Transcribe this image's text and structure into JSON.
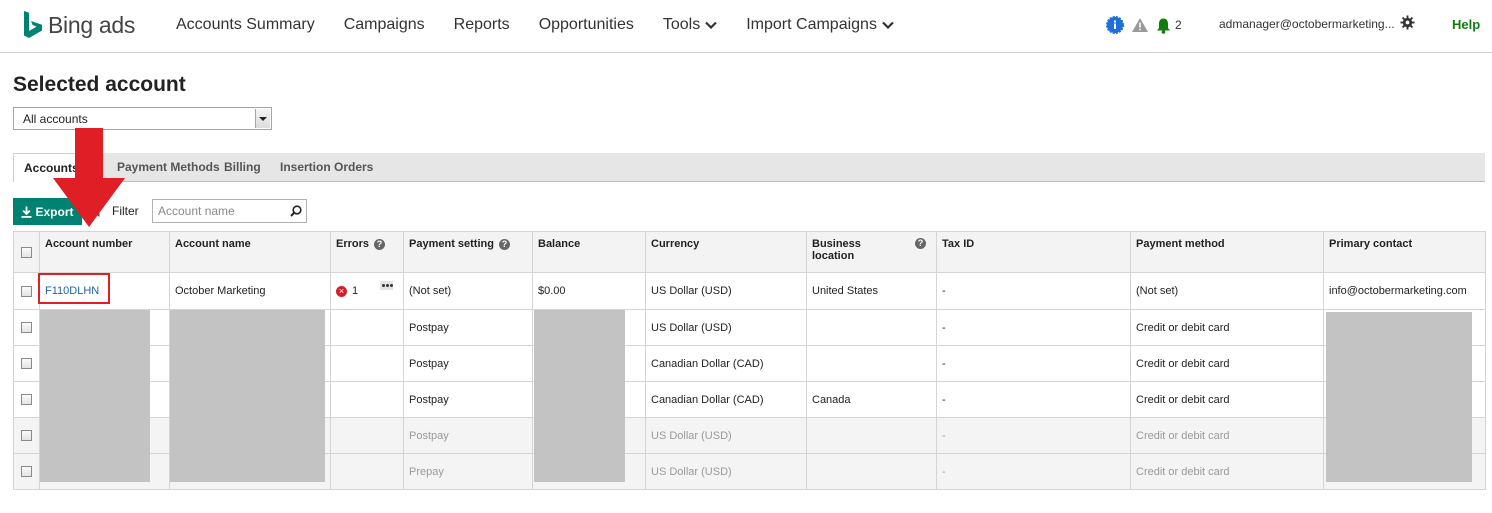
{
  "brand": {
    "name": "Bing ads",
    "color": "#008373"
  },
  "nav": {
    "items": [
      {
        "label": "Accounts Summary",
        "has_dropdown": false
      },
      {
        "label": "Campaigns",
        "has_dropdown": false
      },
      {
        "label": "Reports",
        "has_dropdown": false
      },
      {
        "label": "Opportunities",
        "has_dropdown": false
      },
      {
        "label": "Tools",
        "has_dropdown": true
      },
      {
        "label": "Import Campaigns",
        "has_dropdown": true
      }
    ],
    "notification_count": "2",
    "user_email": "admanager@octobermarketing...",
    "help_label": "Help",
    "icons": [
      "info-badge-icon",
      "warning-icon",
      "bell-icon",
      "gear-icon"
    ]
  },
  "page": {
    "title": "Selected account",
    "account_select": {
      "value": "All accounts"
    }
  },
  "tabs": [
    {
      "label": "Accounts",
      "active": true
    },
    {
      "label": "Payment Methods",
      "active": false
    },
    {
      "label": "Billing",
      "active": false
    },
    {
      "label": "Insertion Orders",
      "active": false
    }
  ],
  "toolbar": {
    "export_label": "Export",
    "filter_label": "Filter",
    "search_placeholder": "Account name"
  },
  "grid": {
    "columns": [
      {
        "label": "Account number"
      },
      {
        "label": "Account name"
      },
      {
        "label": "Errors",
        "help": true
      },
      {
        "label": "Payment setting",
        "help": true
      },
      {
        "label": "Balance"
      },
      {
        "label": "Currency"
      },
      {
        "label": "Business location",
        "help": true
      },
      {
        "label": "Tax ID"
      },
      {
        "label": "Payment method"
      },
      {
        "label": "Primary contact"
      }
    ],
    "rows": [
      {
        "account_number": "F110DLHN",
        "account_name": "October Marketing",
        "errors": "1",
        "payment_setting": "(Not set)",
        "balance": "$0.00",
        "currency": "US Dollar (USD)",
        "business_location": "United States",
        "tax_id": "-",
        "payment_method": "(Not set)",
        "primary_contact": "info@octobermarketing.com",
        "dimmed": false
      },
      {
        "account_number": "",
        "account_name": "",
        "errors": "",
        "payment_setting": "Postpay",
        "balance": "",
        "currency": "US Dollar (USD)",
        "business_location": "",
        "tax_id": "-",
        "payment_method": "Credit or debit card",
        "primary_contact": "",
        "dimmed": false
      },
      {
        "account_number": "",
        "account_name": "",
        "errors": "",
        "payment_setting": "Postpay",
        "balance": "",
        "currency": "Canadian Dollar (CAD)",
        "business_location": "",
        "tax_id": "-",
        "payment_method": "Credit or debit card",
        "primary_contact": "",
        "dimmed": false
      },
      {
        "account_number": "",
        "account_name": "",
        "errors": "",
        "payment_setting": "Postpay",
        "balance": "",
        "currency": "Canadian Dollar (CAD)",
        "business_location": "Canada",
        "tax_id": "-",
        "payment_method": "Credit or debit card",
        "primary_contact": "",
        "dimmed": false
      },
      {
        "account_number": "",
        "account_name": "",
        "errors": "",
        "payment_setting": "Postpay",
        "balance": "",
        "currency": "US Dollar (USD)",
        "business_location": "",
        "tax_id": "-",
        "payment_method": "Credit or debit card",
        "primary_contact": "",
        "dimmed": true
      },
      {
        "account_number": "",
        "account_name": "",
        "errors": "",
        "payment_setting": "Prepay",
        "balance": "",
        "currency": "US Dollar (USD)",
        "business_location": "",
        "tax_id": "-",
        "payment_method": "Credit or debit card",
        "primary_contact": "",
        "dimmed": true
      }
    ]
  },
  "annotation": {
    "arrow_color": "#e01e26",
    "highlight_color": "#e01e26"
  }
}
